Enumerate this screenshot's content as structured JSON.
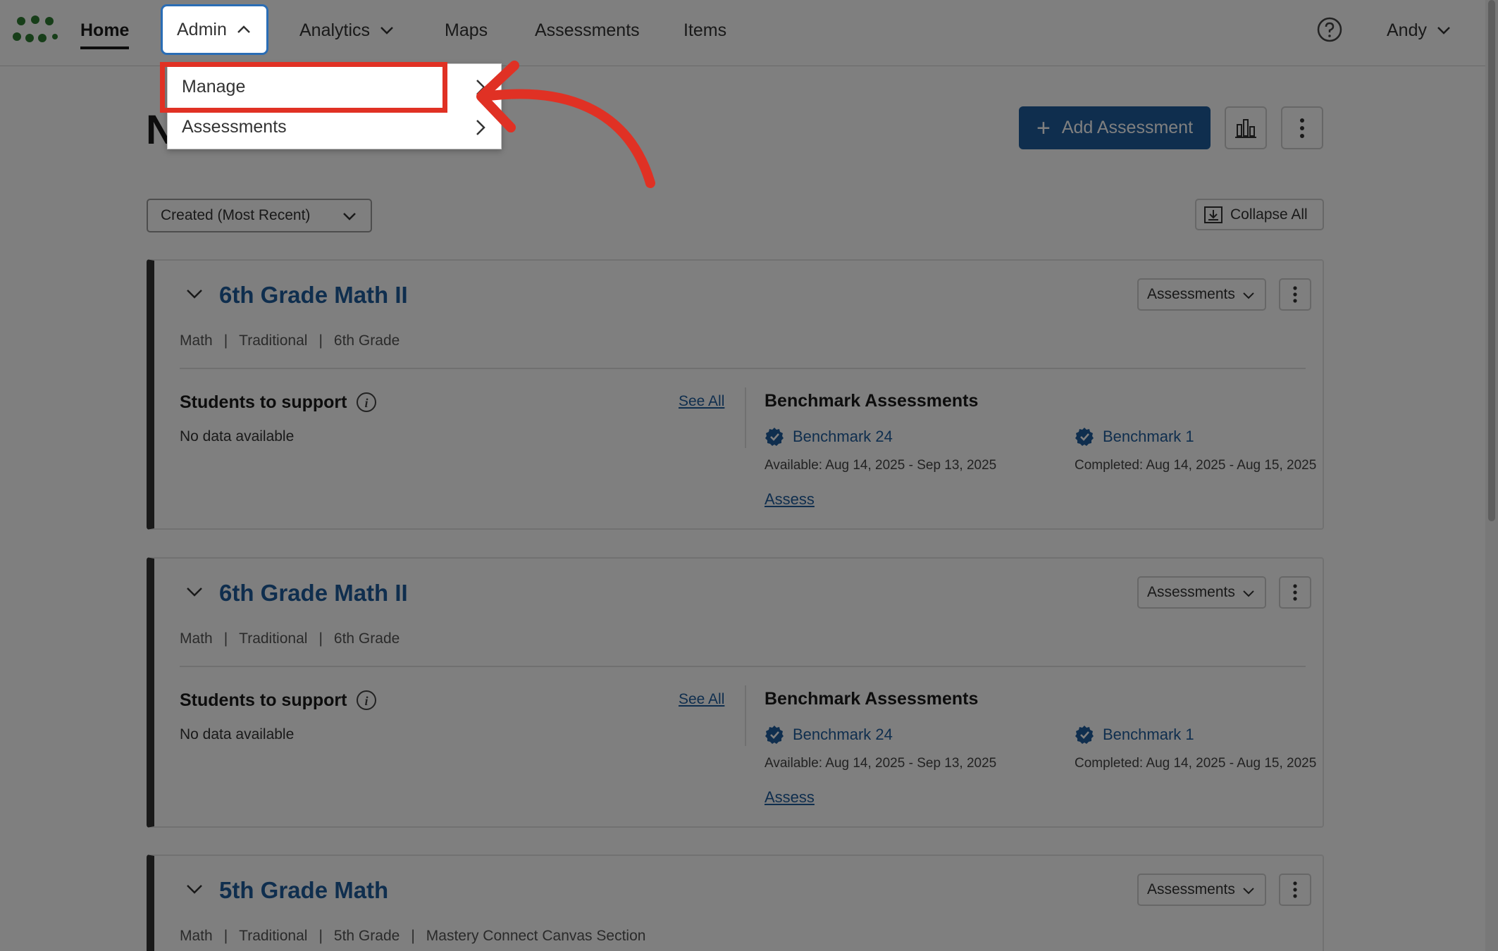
{
  "nav": {
    "home": "Home",
    "admin": "Admin",
    "analytics": "Analytics",
    "maps": "Maps",
    "assessments": "Assessments",
    "items": "Items",
    "user": "Andy"
  },
  "admin_menu": {
    "manage": "Manage",
    "assessments": "Assessments"
  },
  "page": {
    "title": "N",
    "add_assessment": "Add Assessment",
    "sort_value": "Created (Most Recent)",
    "collapse_all": "Collapse All"
  },
  "cards": [
    {
      "title": "6th Grade Math II",
      "meta": [
        "Math",
        "Traditional",
        "6th Grade"
      ],
      "assessments_dd": "Assessments",
      "support_title": "Students to support",
      "see_all": "See All",
      "no_data": "No data available",
      "bench_title": "Benchmark Assessments",
      "bench_a": "Benchmark 24",
      "bench_a_date": "Available: Aug 14, 2025 - Sep 13, 2025",
      "bench_b": "Benchmark 1",
      "bench_b_date": "Completed: Aug 14, 2025 - Aug 15, 2025",
      "assess_link": "Assess"
    },
    {
      "title": "6th Grade Math II",
      "meta": [
        "Math",
        "Traditional",
        "6th Grade"
      ],
      "assessments_dd": "Assessments",
      "support_title": "Students to support",
      "see_all": "See All",
      "no_data": "No data available",
      "bench_title": "Benchmark Assessments",
      "bench_a": "Benchmark 24",
      "bench_a_date": "Available: Aug 14, 2025 - Sep 13, 2025",
      "bench_b": "Benchmark 1",
      "bench_b_date": "Completed: Aug 14, 2025 - Aug 15, 2025",
      "assess_link": "Assess"
    },
    {
      "title": "5th Grade Math",
      "meta": [
        "Math",
        "Traditional",
        "5th Grade",
        "Mastery Connect Canvas Section"
      ],
      "assessments_dd": "Assessments"
    }
  ],
  "colors": {
    "brand_blue": "#1f5c9c",
    "highlight_red": "#e03124",
    "logo_green": "#2e7d32"
  }
}
